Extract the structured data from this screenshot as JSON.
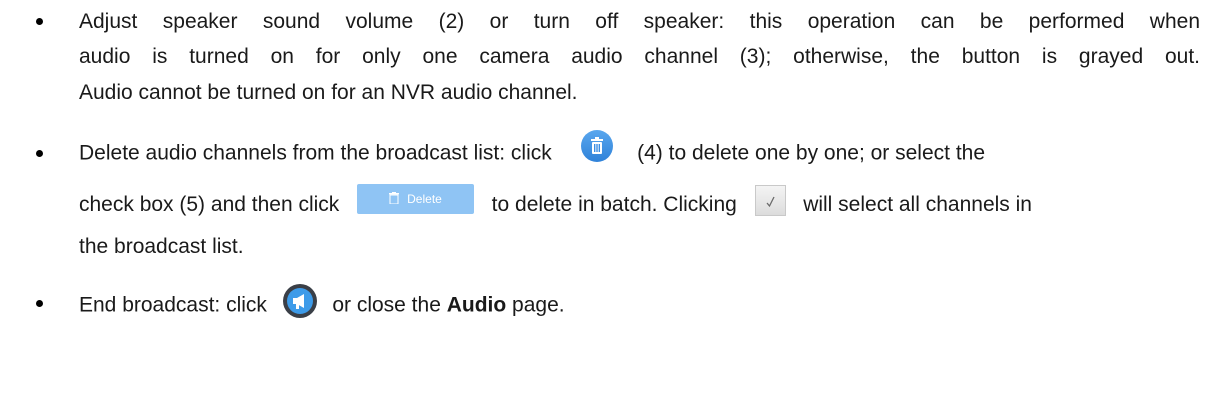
{
  "items": [
    {
      "lines": [
        "Adjust speaker sound volume (2) or turn off speaker: this operation can be performed when",
        "audio is turned on for only one camera audio channel (3); otherwise, the button is grayed out.",
        "Audio cannot be turned on for an NVR audio channel."
      ]
    },
    {
      "line1_before": "Delete audio channels from the broadcast list: click",
      "line1_after": "(4) to delete one by one; or select the",
      "line2_before": "check box (5) and then click",
      "line2_mid": "to delete in batch. Clicking",
      "line2_after": "will select all channels in",
      "line3": "the broadcast list.",
      "delete_button_label": "Delete"
    },
    {
      "before": "End broadcast: click",
      "after_a": "or close the",
      "bold": "Audio",
      "after_b": "page."
    }
  ],
  "icons": [
    "trash-circle-icon",
    "delete-button-icon",
    "select-all-check-icon",
    "broadcast-speaker-icon"
  ],
  "colors": {
    "trash_icon": "#3b8ee3",
    "delete_button": "#8fc4f4",
    "speaker_icon": "#3a3f47",
    "speaker_accent": "#3d9be9"
  }
}
